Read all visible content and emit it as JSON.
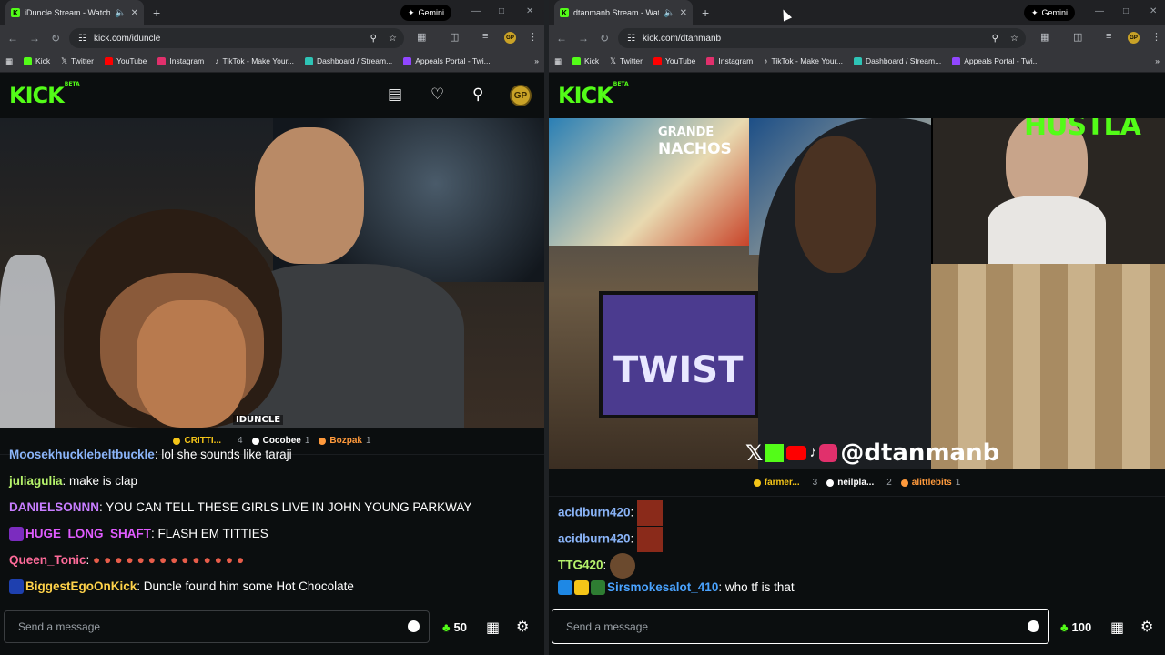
{
  "left": {
    "tab_title": "iDuncle Stream - Watch Liv",
    "gemini_label": "Gemini",
    "url": "kick.com/iduncle",
    "bookmarks": [
      "Kick",
      "Twitter",
      "YouTube",
      "Instagram",
      "TikTok - Make Your...",
      "Dashboard / Stream...",
      "Appeals Portal - Twi..."
    ],
    "logo": "KICK",
    "logo_beta": "BETA",
    "avatar": "GP",
    "video_overlay": "IDUNCLE",
    "gifters": [
      {
        "name": "CRITTI...",
        "count": "4",
        "color": "#f5c518"
      },
      {
        "name": "Cocobee",
        "count": "1",
        "color": "#ffffff"
      },
      {
        "name": "Bozpak",
        "count": "1",
        "color": "#ff9a3c"
      }
    ],
    "messages": [
      {
        "user": "Moosekhucklebeltbuckle",
        "sep": ": ",
        "text": "lol she sounds like taraji",
        "color": "#8ab4f8"
      },
      {
        "user": "juliagulia",
        "sep": ": ",
        "text": "make is clap",
        "color": "#b6f36b"
      },
      {
        "user": "DANIELSONNN",
        "sep": ": ",
        "text": "YOU CAN TELL THESE GIRLS LIVE IN JOHN YOUNG PARKWAY",
        "color": "#c77dff"
      },
      {
        "user": "HUGE_LONG_SHAFT",
        "sep": ": ",
        "text": "FLASH EM TITTIES",
        "color": "#e05cff"
      },
      {
        "user": "Queen_Tonic",
        "sep": ": ",
        "text": "",
        "color": "#ff6b9a"
      },
      {
        "user": "BiggestEgoOnKick",
        "sep": ": ",
        "text": "Duncle found him some Hot Chocolate",
        "color": "#ffd24a"
      }
    ],
    "input_placeholder": "Send a message",
    "points": "50"
  },
  "right": {
    "tab_title": "dtanmanb Stream - Watch",
    "gemini_label": "Gemini",
    "url": "kick.com/dtanmanb",
    "bookmarks": [
      "Kick",
      "Twitter",
      "YouTube",
      "Instagram",
      "TikTok - Make Your...",
      "Dashboard / Stream...",
      "Appeals Portal - Twi..."
    ],
    "logo": "KICK",
    "logo_beta": "BETA",
    "cam_overlay": "GP HUSTLA",
    "handle_overlay": "@dtanmanb",
    "menu_text_1": "GRANDE",
    "menu_text_2": "NACHOS",
    "screen_text": "TWIST",
    "gifters": [
      {
        "name": "farmer...",
        "count": "3",
        "color": "#f5c518"
      },
      {
        "name": "neilpla...",
        "count": "2",
        "color": "#ffffff"
      },
      {
        "name": "alittlebits",
        "count": "1",
        "color": "#ff9a3c"
      }
    ],
    "messages": [
      {
        "user": "acidburn420",
        "sep": ":",
        "text": "",
        "color": "#8ab4f8"
      },
      {
        "user": "acidburn420",
        "sep": ":",
        "text": "",
        "color": "#8ab4f8"
      },
      {
        "user": "TTG420",
        "sep": ":",
        "text": "",
        "color": "#b6f36b"
      },
      {
        "user": "Sirsmokesalot_410",
        "sep": ": ",
        "text": "who tf is that",
        "color": "#4aa3ff"
      }
    ],
    "input_placeholder": "Send a message",
    "points": "100"
  }
}
